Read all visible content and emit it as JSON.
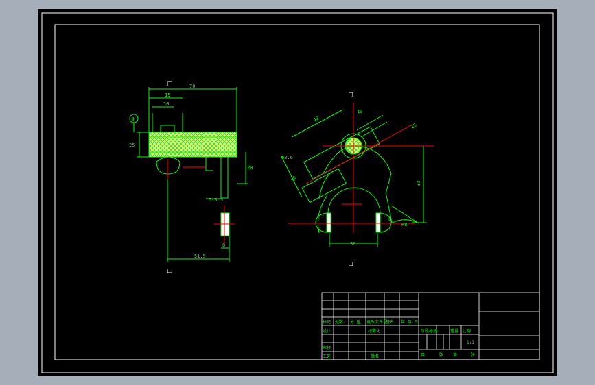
{
  "viewport": {
    "background": "#a6aeba",
    "paper": "#000000"
  },
  "colors": {
    "outline": "#00ff00",
    "centerline": "#ff0000",
    "dimension": "#00ff00",
    "hatch": "#00c8ff",
    "section_fill": "#ffff00",
    "text": "#00ff00",
    "frame": "#ffffff",
    "corner": "#ffffff"
  },
  "left_view": {
    "dims": {
      "overall_width": "70",
      "top_width": "15",
      "slot_width": "10",
      "left_height": "25",
      "stem_height": "20",
      "base_width": "51.5",
      "pin_width": "8",
      "step": "5-0.5"
    },
    "datum_label": "Ⅱ"
  },
  "right_view": {
    "dims": {
      "arm_length": "40",
      "arm_width": "15",
      "slot": "10",
      "fork_gap": "38",
      "height": "33",
      "radius": "R8",
      "diameter": "Φ8.6",
      "angle": "8",
      "ref": "10"
    }
  },
  "title_block": {
    "rows_left": [
      [
        "标记",
        "处数",
        "分 区",
        "更改文件号",
        "签名",
        "年.月.日"
      ],
      [
        "设计",
        "",
        "",
        "标准化",
        "",
        ""
      ],
      [
        "审核",
        "",
        "",
        "",
        "",
        ""
      ],
      [
        "工艺",
        "",
        "",
        "批准",
        "",
        ""
      ]
    ],
    "mid_labels": [
      "阶段标记",
      "重量",
      "比例"
    ],
    "scale": "1:1",
    "sheet_labels": [
      "共",
      "张",
      "第",
      "张"
    ]
  }
}
